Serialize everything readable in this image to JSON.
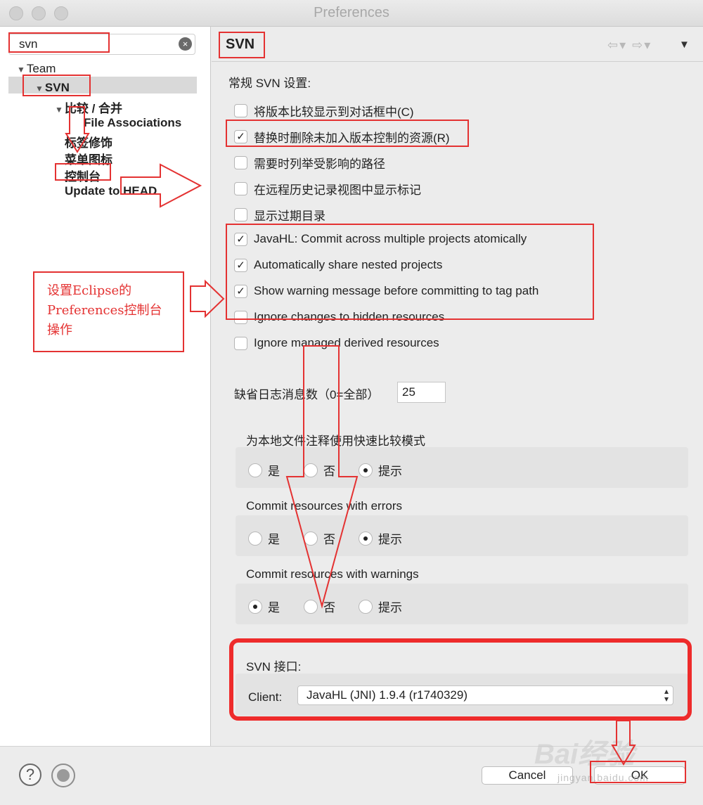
{
  "window": {
    "title": "Preferences"
  },
  "sidebar": {
    "filter_value": "svn",
    "clear_icon": "×",
    "tree": [
      {
        "label": "Team"
      },
      {
        "label": "SVN"
      },
      {
        "label": "比较 / 合并"
      },
      {
        "label": "File Associations"
      },
      {
        "label": "标签修饰"
      },
      {
        "label": "菜单图标"
      },
      {
        "label": "控制台"
      },
      {
        "label": "Update to HEAD"
      }
    ]
  },
  "page": {
    "title": "SVN",
    "general_label": "常规 SVN 设置:",
    "checkboxes": [
      {
        "label": "将版本比较显示到对话框中(C)",
        "checked": false,
        "mark": ""
      },
      {
        "label": "替换时删除未加入版本控制的资源(R)",
        "checked": true,
        "mark": "✓"
      },
      {
        "label": "需要时列举受影响的路径",
        "checked": false,
        "mark": ""
      },
      {
        "label": "在远程历史记录视图中显示标记",
        "checked": false,
        "mark": ""
      },
      {
        "label": "显示过期目录",
        "checked": false,
        "mark": ""
      },
      {
        "label": "JavaHL: Commit across multiple projects atomically",
        "checked": true,
        "mark": "✓"
      },
      {
        "label": "Automatically share nested projects",
        "checked": true,
        "mark": "✓"
      },
      {
        "label": "Show warning message before committing to tag path",
        "checked": true,
        "mark": "✓"
      },
      {
        "label": "Ignore changes to hidden resources",
        "checked": false,
        "mark": ""
      },
      {
        "label": "Ignore managed derived resources",
        "checked": false,
        "mark": ""
      }
    ],
    "log_label": "缺省日志消息数（0=全部）",
    "log_value": "25",
    "groups": [
      {
        "label": "为本地文件注释使用快速比较模式",
        "options": [
          "是",
          "否",
          "提示"
        ],
        "selected": "提示"
      },
      {
        "label": "Commit resources with errors",
        "options": [
          "是",
          "否",
          "提示"
        ],
        "selected": "提示"
      },
      {
        "label": "Commit resources with warnings",
        "options": [
          "是",
          "否",
          "提示"
        ],
        "selected": "是"
      }
    ],
    "interface_label": "SVN 接口:",
    "client_label": "Client:",
    "client_value": "JavaHL (JNI) 1.9.4 (r1740329)"
  },
  "buttons": {
    "help": "?",
    "cancel": "Cancel",
    "ok": "OK"
  },
  "annotation": {
    "note": "设置Eclipse的\nPreferences控制台\n操作"
  },
  "watermark": {
    "main": "Bai经验",
    "sub": "jingyan.baidu.com"
  },
  "colors": {
    "annotation": "#e43232",
    "selection": "#d9d9d9"
  }
}
